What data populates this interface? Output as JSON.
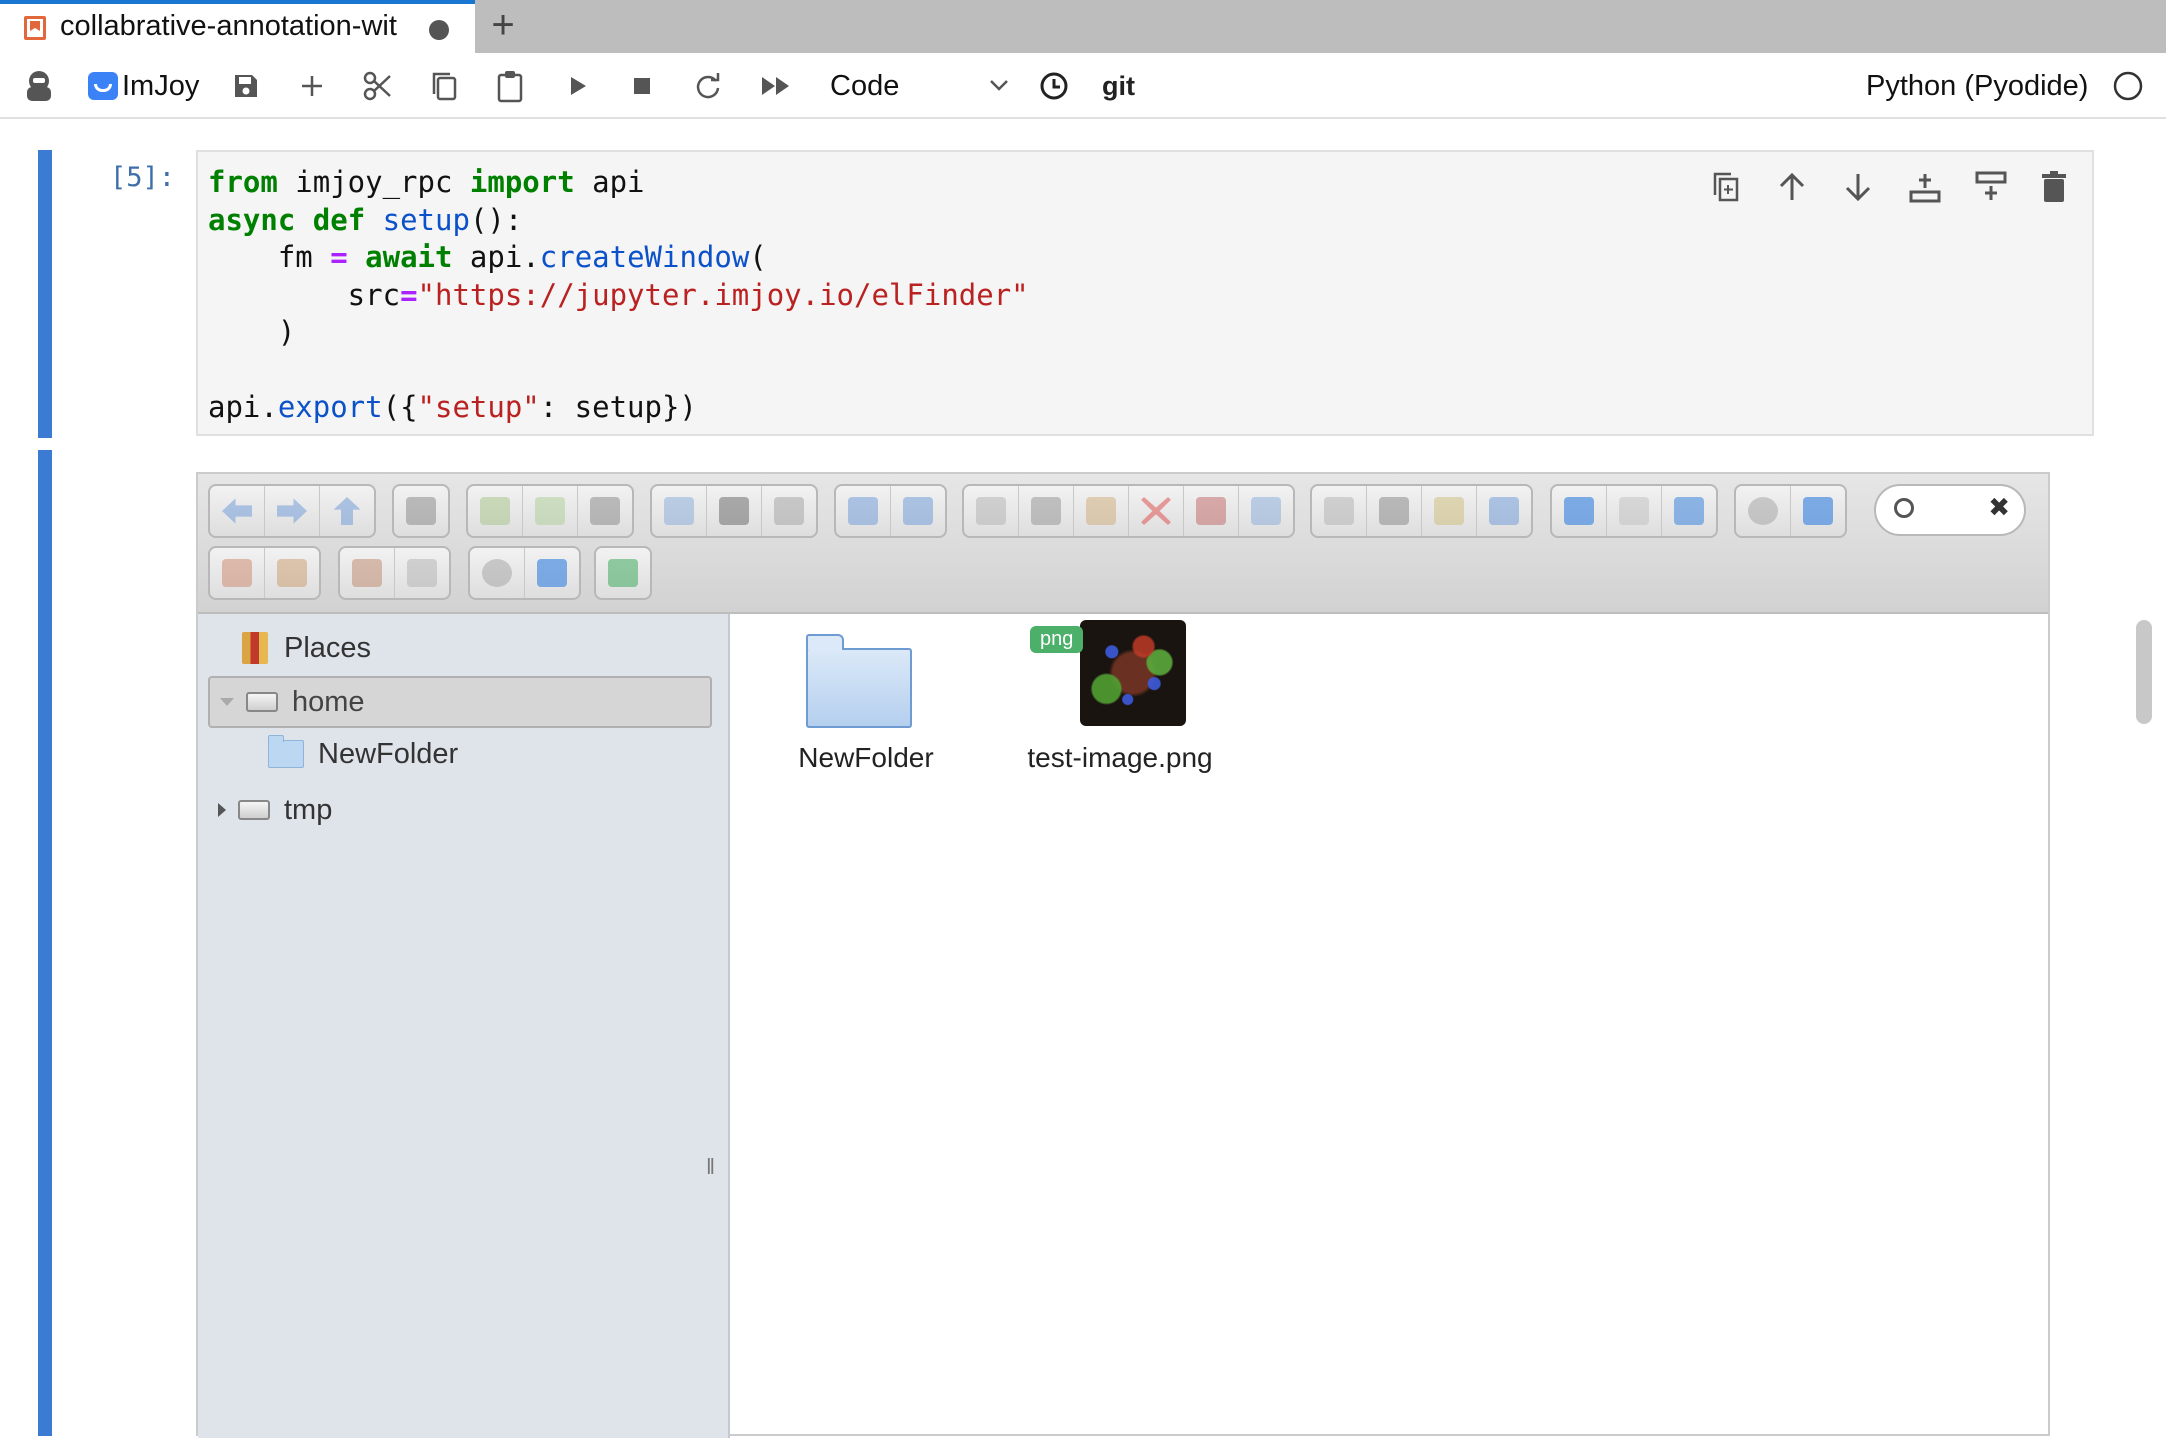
{
  "tab": {
    "title": "collabrative-annotation-wit",
    "new_tab": "+"
  },
  "toolbar": {
    "imjoy_label": "ImJoy",
    "cell_type": "Code",
    "git_label": "git",
    "kernel_name": "Python (Pyodide)"
  },
  "cell": {
    "prompt": "[5]:"
  },
  "elfinder": {
    "tree": {
      "places": "Places",
      "home": "home",
      "new_folder": "NewFolder",
      "tmp": "tmp"
    },
    "files": [
      {
        "name": "NewFolder",
        "kind": "folder"
      },
      {
        "name": "test-image.png",
        "kind": "image",
        "badge": "png"
      }
    ],
    "search_clear": "✖"
  },
  "colors": {
    "accent": "#3b7bd4",
    "tab_accent": "#e2673a",
    "badge": "#4caf6a"
  }
}
